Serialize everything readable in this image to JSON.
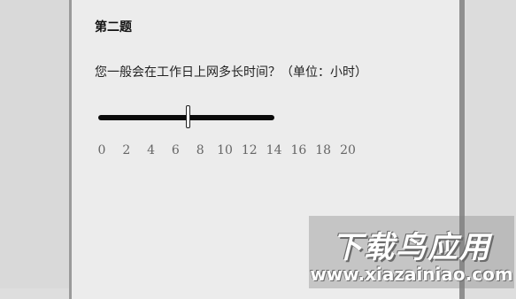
{
  "question": {
    "title": "第二题",
    "text": "您一般会在工作日上网多长时间？（单位：小时）"
  },
  "slider": {
    "min": 0,
    "max": 20,
    "value": 7,
    "filled_to": 14,
    "ticks": [
      "0",
      "2",
      "4",
      "6",
      "8",
      "10",
      "12",
      "14",
      "16",
      "18",
      "20"
    ]
  },
  "watermark": {
    "name": "下载鸟应用",
    "url": "www.xiazainiao.com"
  }
}
